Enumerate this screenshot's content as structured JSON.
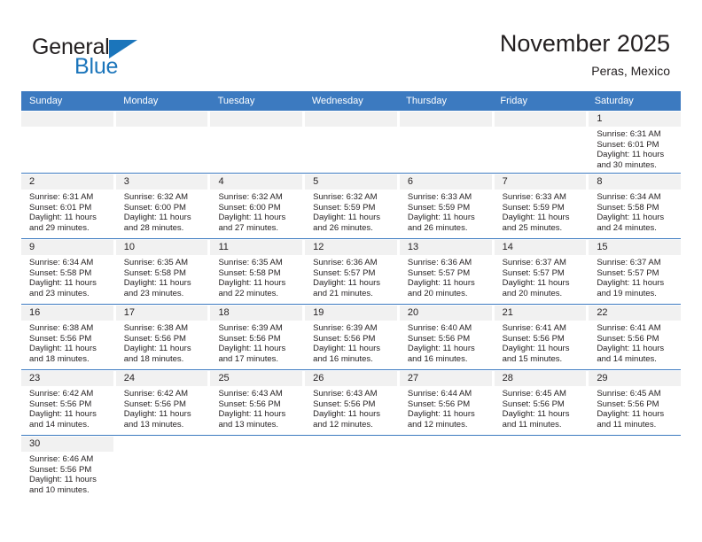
{
  "brand": {
    "name_top": "General",
    "name_bottom": "Blue",
    "accent_color": "#1b75bb"
  },
  "header": {
    "title": "November 2025",
    "subtitle": "Peras, Mexico"
  },
  "theme": {
    "header_row_color": "#3c7ac0",
    "day_number_band_color": "#f1f1f1",
    "row_separator_color": "#3c7ac0",
    "text_color": "#231f20"
  },
  "weekdays": [
    "Sunday",
    "Monday",
    "Tuesday",
    "Wednesday",
    "Thursday",
    "Friday",
    "Saturday"
  ],
  "labels": {
    "sunrise_prefix": "Sunrise: ",
    "sunset_prefix": "Sunset: ",
    "daylight_prefix": "Daylight: "
  },
  "weeks": [
    [
      {
        "day": "",
        "sunrise": "",
        "sunset": "",
        "daylight_line1": "",
        "daylight_line2": ""
      },
      {
        "day": "",
        "sunrise": "",
        "sunset": "",
        "daylight_line1": "",
        "daylight_line2": ""
      },
      {
        "day": "",
        "sunrise": "",
        "sunset": "",
        "daylight_line1": "",
        "daylight_line2": ""
      },
      {
        "day": "",
        "sunrise": "",
        "sunset": "",
        "daylight_line1": "",
        "daylight_line2": ""
      },
      {
        "day": "",
        "sunrise": "",
        "sunset": "",
        "daylight_line1": "",
        "daylight_line2": ""
      },
      {
        "day": "",
        "sunrise": "",
        "sunset": "",
        "daylight_line1": "",
        "daylight_line2": ""
      },
      {
        "day": "1",
        "sunrise": "Sunrise: 6:31 AM",
        "sunset": "Sunset: 6:01 PM",
        "daylight_line1": "Daylight: 11 hours",
        "daylight_line2": "and 30 minutes."
      }
    ],
    [
      {
        "day": "2",
        "sunrise": "Sunrise: 6:31 AM",
        "sunset": "Sunset: 6:01 PM",
        "daylight_line1": "Daylight: 11 hours",
        "daylight_line2": "and 29 minutes."
      },
      {
        "day": "3",
        "sunrise": "Sunrise: 6:32 AM",
        "sunset": "Sunset: 6:00 PM",
        "daylight_line1": "Daylight: 11 hours",
        "daylight_line2": "and 28 minutes."
      },
      {
        "day": "4",
        "sunrise": "Sunrise: 6:32 AM",
        "sunset": "Sunset: 6:00 PM",
        "daylight_line1": "Daylight: 11 hours",
        "daylight_line2": "and 27 minutes."
      },
      {
        "day": "5",
        "sunrise": "Sunrise: 6:32 AM",
        "sunset": "Sunset: 5:59 PM",
        "daylight_line1": "Daylight: 11 hours",
        "daylight_line2": "and 26 minutes."
      },
      {
        "day": "6",
        "sunrise": "Sunrise: 6:33 AM",
        "sunset": "Sunset: 5:59 PM",
        "daylight_line1": "Daylight: 11 hours",
        "daylight_line2": "and 26 minutes."
      },
      {
        "day": "7",
        "sunrise": "Sunrise: 6:33 AM",
        "sunset": "Sunset: 5:59 PM",
        "daylight_line1": "Daylight: 11 hours",
        "daylight_line2": "and 25 minutes."
      },
      {
        "day": "8",
        "sunrise": "Sunrise: 6:34 AM",
        "sunset": "Sunset: 5:58 PM",
        "daylight_line1": "Daylight: 11 hours",
        "daylight_line2": "and 24 minutes."
      }
    ],
    [
      {
        "day": "9",
        "sunrise": "Sunrise: 6:34 AM",
        "sunset": "Sunset: 5:58 PM",
        "daylight_line1": "Daylight: 11 hours",
        "daylight_line2": "and 23 minutes."
      },
      {
        "day": "10",
        "sunrise": "Sunrise: 6:35 AM",
        "sunset": "Sunset: 5:58 PM",
        "daylight_line1": "Daylight: 11 hours",
        "daylight_line2": "and 23 minutes."
      },
      {
        "day": "11",
        "sunrise": "Sunrise: 6:35 AM",
        "sunset": "Sunset: 5:58 PM",
        "daylight_line1": "Daylight: 11 hours",
        "daylight_line2": "and 22 minutes."
      },
      {
        "day": "12",
        "sunrise": "Sunrise: 6:36 AM",
        "sunset": "Sunset: 5:57 PM",
        "daylight_line1": "Daylight: 11 hours",
        "daylight_line2": "and 21 minutes."
      },
      {
        "day": "13",
        "sunrise": "Sunrise: 6:36 AM",
        "sunset": "Sunset: 5:57 PM",
        "daylight_line1": "Daylight: 11 hours",
        "daylight_line2": "and 20 minutes."
      },
      {
        "day": "14",
        "sunrise": "Sunrise: 6:37 AM",
        "sunset": "Sunset: 5:57 PM",
        "daylight_line1": "Daylight: 11 hours",
        "daylight_line2": "and 20 minutes."
      },
      {
        "day": "15",
        "sunrise": "Sunrise: 6:37 AM",
        "sunset": "Sunset: 5:57 PM",
        "daylight_line1": "Daylight: 11 hours",
        "daylight_line2": "and 19 minutes."
      }
    ],
    [
      {
        "day": "16",
        "sunrise": "Sunrise: 6:38 AM",
        "sunset": "Sunset: 5:56 PM",
        "daylight_line1": "Daylight: 11 hours",
        "daylight_line2": "and 18 minutes."
      },
      {
        "day": "17",
        "sunrise": "Sunrise: 6:38 AM",
        "sunset": "Sunset: 5:56 PM",
        "daylight_line1": "Daylight: 11 hours",
        "daylight_line2": "and 18 minutes."
      },
      {
        "day": "18",
        "sunrise": "Sunrise: 6:39 AM",
        "sunset": "Sunset: 5:56 PM",
        "daylight_line1": "Daylight: 11 hours",
        "daylight_line2": "and 17 minutes."
      },
      {
        "day": "19",
        "sunrise": "Sunrise: 6:39 AM",
        "sunset": "Sunset: 5:56 PM",
        "daylight_line1": "Daylight: 11 hours",
        "daylight_line2": "and 16 minutes."
      },
      {
        "day": "20",
        "sunrise": "Sunrise: 6:40 AM",
        "sunset": "Sunset: 5:56 PM",
        "daylight_line1": "Daylight: 11 hours",
        "daylight_line2": "and 16 minutes."
      },
      {
        "day": "21",
        "sunrise": "Sunrise: 6:41 AM",
        "sunset": "Sunset: 5:56 PM",
        "daylight_line1": "Daylight: 11 hours",
        "daylight_line2": "and 15 minutes."
      },
      {
        "day": "22",
        "sunrise": "Sunrise: 6:41 AM",
        "sunset": "Sunset: 5:56 PM",
        "daylight_line1": "Daylight: 11 hours",
        "daylight_line2": "and 14 minutes."
      }
    ],
    [
      {
        "day": "23",
        "sunrise": "Sunrise: 6:42 AM",
        "sunset": "Sunset: 5:56 PM",
        "daylight_line1": "Daylight: 11 hours",
        "daylight_line2": "and 14 minutes."
      },
      {
        "day": "24",
        "sunrise": "Sunrise: 6:42 AM",
        "sunset": "Sunset: 5:56 PM",
        "daylight_line1": "Daylight: 11 hours",
        "daylight_line2": "and 13 minutes."
      },
      {
        "day": "25",
        "sunrise": "Sunrise: 6:43 AM",
        "sunset": "Sunset: 5:56 PM",
        "daylight_line1": "Daylight: 11 hours",
        "daylight_line2": "and 13 minutes."
      },
      {
        "day": "26",
        "sunrise": "Sunrise: 6:43 AM",
        "sunset": "Sunset: 5:56 PM",
        "daylight_line1": "Daylight: 11 hours",
        "daylight_line2": "and 12 minutes."
      },
      {
        "day": "27",
        "sunrise": "Sunrise: 6:44 AM",
        "sunset": "Sunset: 5:56 PM",
        "daylight_line1": "Daylight: 11 hours",
        "daylight_line2": "and 12 minutes."
      },
      {
        "day": "28",
        "sunrise": "Sunrise: 6:45 AM",
        "sunset": "Sunset: 5:56 PM",
        "daylight_line1": "Daylight: 11 hours",
        "daylight_line2": "and 11 minutes."
      },
      {
        "day": "29",
        "sunrise": "Sunrise: 6:45 AM",
        "sunset": "Sunset: 5:56 PM",
        "daylight_line1": "Daylight: 11 hours",
        "daylight_line2": "and 11 minutes."
      }
    ],
    [
      {
        "day": "30",
        "sunrise": "Sunrise: 6:46 AM",
        "sunset": "Sunset: 5:56 PM",
        "daylight_line1": "Daylight: 11 hours",
        "daylight_line2": "and 10 minutes."
      },
      {
        "day": "",
        "sunrise": "",
        "sunset": "",
        "daylight_line1": "",
        "daylight_line2": ""
      },
      {
        "day": "",
        "sunrise": "",
        "sunset": "",
        "daylight_line1": "",
        "daylight_line2": ""
      },
      {
        "day": "",
        "sunrise": "",
        "sunset": "",
        "daylight_line1": "",
        "daylight_line2": ""
      },
      {
        "day": "",
        "sunrise": "",
        "sunset": "",
        "daylight_line1": "",
        "daylight_line2": ""
      },
      {
        "day": "",
        "sunrise": "",
        "sunset": "",
        "daylight_line1": "",
        "daylight_line2": ""
      },
      {
        "day": "",
        "sunrise": "",
        "sunset": "",
        "daylight_line1": "",
        "daylight_line2": ""
      }
    ]
  ]
}
